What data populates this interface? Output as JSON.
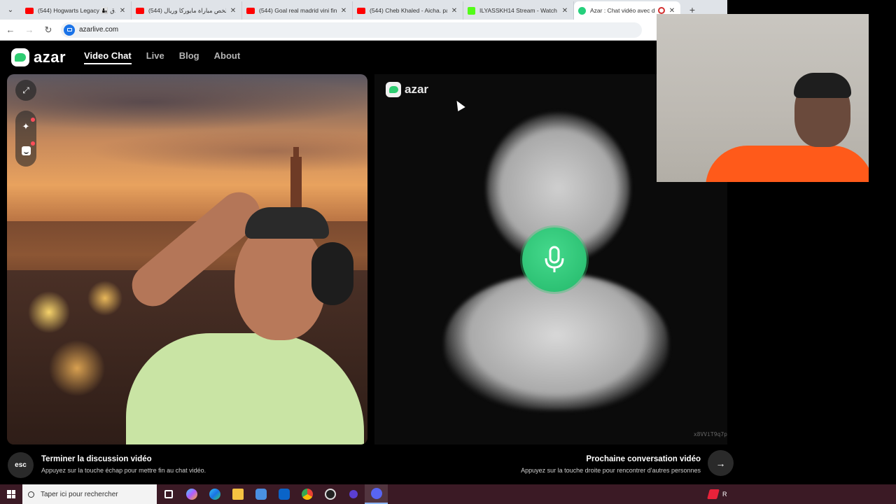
{
  "browser": {
    "tabs": [
      {
        "title": "(544) Hogwarts Legacy 👨‍👦 ق...",
        "favicon": "youtube-icon",
        "active": false
      },
      {
        "title": "(544) ملخص مباراة مايوركا وريال...",
        "favicon": "youtube-icon",
        "active": false
      },
      {
        "title": "(544) Goal real madrid vini final...",
        "favicon": "youtube-icon",
        "active": false
      },
      {
        "title": "(544) Cheb Khaled - Aicha. para...",
        "favicon": "youtube-icon",
        "active": false
      },
      {
        "title": "ILYASSKH14 Stream - Watch Liv...",
        "favicon": "kick-icon",
        "active": false
      },
      {
        "title": "Azar : Chat vidéo avec de no...",
        "favicon": "azar-icon",
        "active": true
      }
    ],
    "url": "azarlive.com"
  },
  "site": {
    "logo_text": "azar",
    "nav": [
      {
        "label": "Video Chat",
        "active": true
      },
      {
        "label": "Live",
        "active": false
      },
      {
        "label": "Blog",
        "active": false
      },
      {
        "label": "About",
        "active": false
      }
    ]
  },
  "remote": {
    "logo_text": "azar",
    "watermark": "x8VViT9q7p"
  },
  "controls": {
    "end": {
      "key": "esc",
      "title": "Terminer la discussion vidéo",
      "subtitle": "Appuyez sur la touche échap pour mettre fin au chat vidéo."
    },
    "next": {
      "title": "Prochaine conversation vidéo",
      "subtitle": "Appuyez sur la touche droite pour rencontrer d'autres personnes",
      "icon": "arrow-right-icon"
    }
  },
  "taskbar": {
    "search_placeholder": "Taper ici pour rechercher",
    "right_text": "R"
  },
  "colors": {
    "accent_green": "#2ecc71",
    "taskbar_bg": "#3b1a25"
  }
}
